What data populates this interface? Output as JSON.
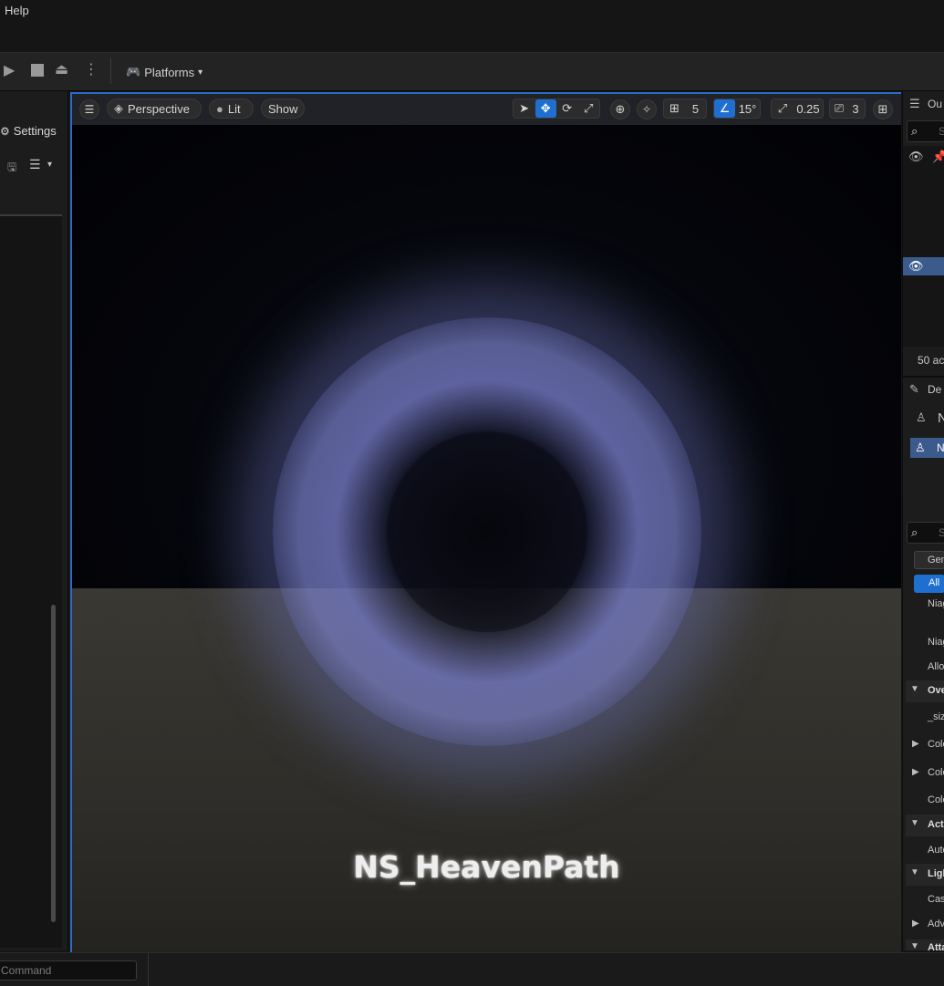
{
  "menu": {
    "help": "Help"
  },
  "toolbar": {
    "play_icon": "play-icon",
    "stop_icon": "stop-icon",
    "eject_icon": "eject-icon",
    "more_icon": "kebab-icon",
    "platforms_label": "Platforms"
  },
  "left_panel": {
    "settings_label": "Settings"
  },
  "viewport": {
    "view_mode": "Perspective",
    "lighting_mode": "Lit",
    "show_label": "Show",
    "grid_size": "5",
    "rotation_snap": "15°",
    "scale_snap": "0.25",
    "camera_speed": "3",
    "overlay_text": "NS_HeavenPath"
  },
  "right_panel": {
    "outliner_tab": "Ou",
    "search_placeholder": "S",
    "actor_count": "50 ac",
    "details_tab": "De",
    "selected_header": "N",
    "selected_row": "N",
    "details_search_placeholder": "S",
    "filter_general": "Gen",
    "filter_all": "All",
    "rows": [
      "Niag",
      "Niag",
      "Allo",
      "Ove",
      "_siz",
      "Colo",
      "Colo",
      "Colo",
      "Acti",
      "Auto",
      "Ligh",
      "Cas",
      "Adv",
      "Atta"
    ]
  },
  "status": {
    "command_placeholder": "Command"
  },
  "colors": {
    "accent": "#1f6fd1",
    "viewport_border": "#2b6cc4"
  }
}
